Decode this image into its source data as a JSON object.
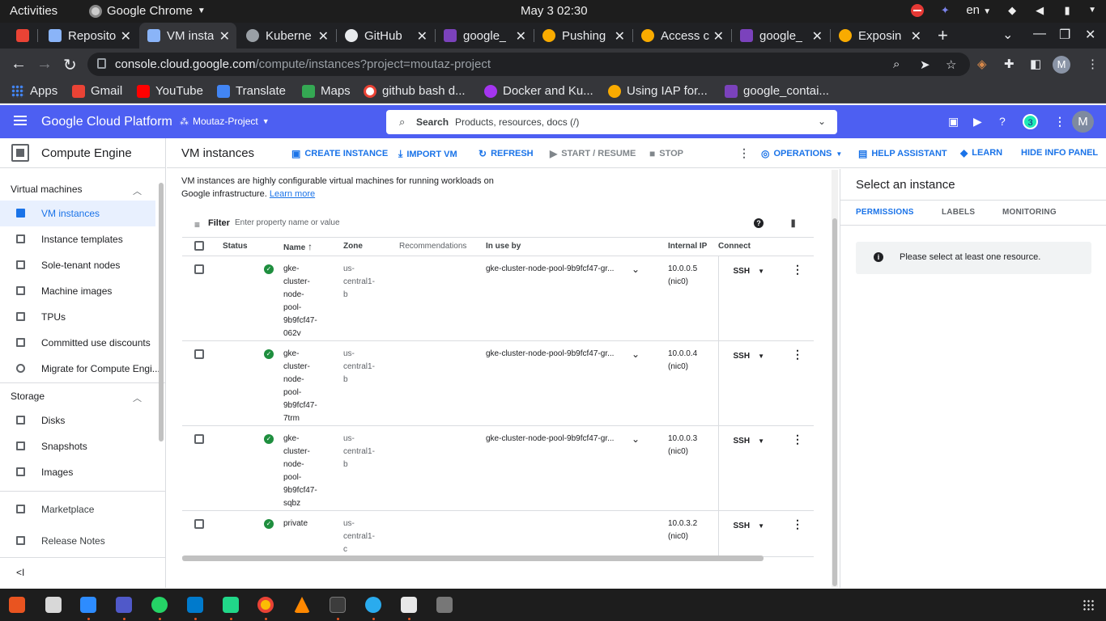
{
  "gnome": {
    "activities": "Activities",
    "app_name": "Google Chrome",
    "clock": "May 3  02:30",
    "lang": "en"
  },
  "tabs": [
    {
      "label": "",
      "color": "#ea4335"
    },
    {
      "label": "Reposito",
      "color": "#8ab4f8"
    },
    {
      "label": "VM insta",
      "color": "#8ab4f8"
    },
    {
      "label": "Kuberne",
      "color": "#9aa0a6"
    },
    {
      "label": "GitHub",
      "color": "#e8eaed"
    },
    {
      "label": "google_",
      "color": "#7b42bc"
    },
    {
      "label": "Pushing",
      "color": "#f9ab00"
    },
    {
      "label": "Access c",
      "color": "#f9ab00"
    },
    {
      "label": "google_",
      "color": "#7b42bc"
    },
    {
      "label": "Exposin",
      "color": "#f9ab00"
    }
  ],
  "omnibox": {
    "domain": "console.cloud.google.com",
    "path": "/compute/instances?project=moutaz-project"
  },
  "profile_initial": "M",
  "bookmarks": [
    {
      "label": "Apps",
      "color": "#4285f4"
    },
    {
      "label": "Gmail",
      "color": "#ea4335"
    },
    {
      "label": "YouTube",
      "color": "#ff0000"
    },
    {
      "label": "Translate",
      "color": "#4285f4"
    },
    {
      "label": "Maps",
      "color": "#34a853"
    },
    {
      "label": "github bash d...",
      "color": "#ffffff"
    },
    {
      "label": "Docker and Ku...",
      "color": "#a435f0"
    },
    {
      "label": "Using IAP for...",
      "color": "#f9ab00"
    },
    {
      "label": "google_contai...",
      "color": "#7b42bc"
    }
  ],
  "gcp": {
    "brand": "Google Cloud Platform",
    "project": "Moutaz-Project",
    "search_label": "Search",
    "search_placeholder": "Products, resources, docs (/)",
    "notifications": "3",
    "avatar": "M"
  },
  "sidebar": {
    "product": "Compute Engine",
    "section_vm": "Virtual machines",
    "vm_items": [
      "VM instances",
      "Instance templates",
      "Sole-tenant nodes",
      "Machine images",
      "TPUs",
      "Committed use discounts",
      "Migrate for Compute Engi..."
    ],
    "section_storage": "Storage",
    "storage_items": [
      "Disks",
      "Snapshots",
      "Images"
    ],
    "marketplace": "Marketplace",
    "release_notes": "Release Notes",
    "collapse": "<I"
  },
  "main": {
    "title": "VM instances",
    "actions": {
      "create": "CREATE INSTANCE",
      "import": "IMPORT VM",
      "refresh": "REFRESH",
      "start": "START / RESUME",
      "stop": "STOP",
      "operations": "OPERATIONS",
      "help_assistant": "HELP ASSISTANT",
      "learn": "LEARN",
      "hide_info": "HIDE INFO PANEL"
    },
    "description": "VM instances are highly configurable virtual machines for running workloads on Google infrastructure.",
    "learn_more": "Learn more",
    "filter_label": "Filter",
    "filter_placeholder": "Enter property name or value"
  },
  "table": {
    "headers": {
      "status": "Status",
      "name": "Name",
      "zone": "Zone",
      "recommendations": "Recommendations",
      "in_use_by": "In use by",
      "internal_ip": "Internal IP",
      "connect": "Connect"
    },
    "rows": [
      {
        "name": [
          "gke-",
          "cluster-",
          "node-",
          "pool-",
          "9b9fcf47-",
          "062v"
        ],
        "zone": [
          "us-",
          "central1-",
          "b"
        ],
        "in_use_by": "gke-cluster-node-pool-9b9fcf47-gr...",
        "ip": "10.0.0.5",
        "nic": "(nic0)",
        "connect": "SSH"
      },
      {
        "name": [
          "gke-",
          "cluster-",
          "node-",
          "pool-",
          "9b9fcf47-",
          "7trm"
        ],
        "zone": [
          "us-",
          "central1-",
          "b"
        ],
        "in_use_by": "gke-cluster-node-pool-9b9fcf47-gr...",
        "ip": "10.0.0.4",
        "nic": "(nic0)",
        "connect": "SSH"
      },
      {
        "name": [
          "gke-",
          "cluster-",
          "node-",
          "pool-",
          "9b9fcf47-",
          "sqbz"
        ],
        "zone": [
          "us-",
          "central1-",
          "b"
        ],
        "in_use_by": "gke-cluster-node-pool-9b9fcf47-gr...",
        "ip": "10.0.0.3",
        "nic": "(nic0)",
        "connect": "SSH"
      },
      {
        "name": [
          "private"
        ],
        "zone": [
          "us-",
          "central1-",
          "c"
        ],
        "in_use_by": "",
        "ip": "10.0.3.2",
        "nic": "(nic0)",
        "connect": "SSH"
      }
    ]
  },
  "info_panel": {
    "title": "Select an instance",
    "tabs": [
      "PERMISSIONS",
      "LABELS",
      "MONITORING"
    ],
    "message": "Please select at least one resource."
  },
  "dock_apps": [
    {
      "name": "software-icon",
      "color": "#e95420"
    },
    {
      "name": "files-icon",
      "color": "#d8d8d8"
    },
    {
      "name": "zoom-icon",
      "color": "#2d8cff"
    },
    {
      "name": "teams-icon",
      "color": "#5059c9"
    },
    {
      "name": "whatsapp-icon",
      "color": "#25d366"
    },
    {
      "name": "vscode-icon",
      "color": "#007acc"
    },
    {
      "name": "pycharm-icon",
      "color": "#21d789"
    },
    {
      "name": "chrome-icon",
      "color": "#fbbc04"
    },
    {
      "name": "vlc-icon",
      "color": "#ff8800"
    },
    {
      "name": "terminal-icon",
      "color": "#3c3c3c"
    },
    {
      "name": "telegram-icon",
      "color": "#2aabee"
    },
    {
      "name": "writer-icon",
      "color": "#e8e8e8"
    },
    {
      "name": "drive-icon",
      "color": "#777777"
    }
  ]
}
